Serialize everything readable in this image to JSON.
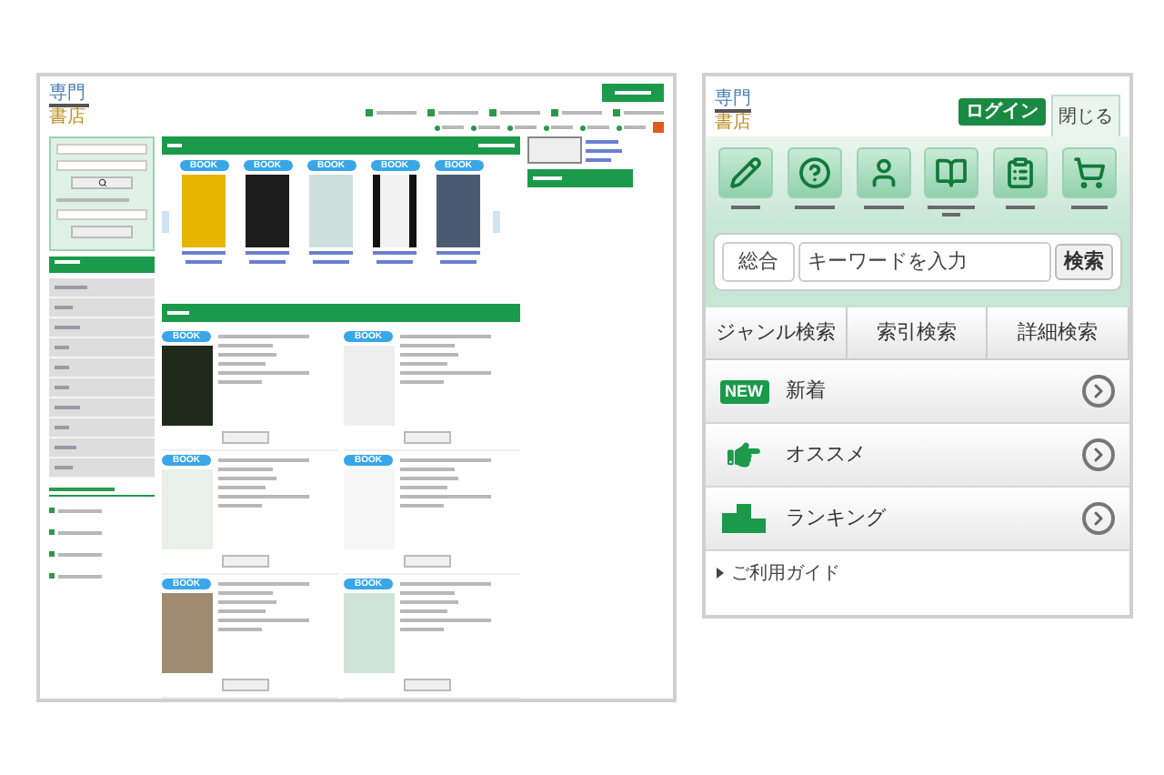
{
  "desktop": {
    "logo": [
      "専門",
      "書店"
    ],
    "new_books": [
      {
        "tag": "BOOK"
      },
      {
        "tag": "BOOK"
      },
      {
        "tag": "BOOK"
      },
      {
        "tag": "BOOK"
      },
      {
        "tag": "BOOK"
      }
    ],
    "recommended": [
      {
        "tag": "BOOK"
      },
      {
        "tag": "BOOK"
      },
      {
        "tag": "BOOK"
      },
      {
        "tag": "BOOK"
      },
      {
        "tag": "BOOK"
      },
      {
        "tag": "BOOK"
      }
    ]
  },
  "mobile": {
    "logo": [
      "専門",
      "書店"
    ],
    "login": "ログイン",
    "close": "閉じる",
    "search": {
      "scope": "総合",
      "placeholder": "キーワードを入力",
      "button": "検索"
    },
    "tabs": [
      "ジャンル検索",
      "索引検索",
      "詳細検索"
    ],
    "list": [
      {
        "kind": "new",
        "badge": "NEW",
        "label": "新着"
      },
      {
        "kind": "recommend",
        "label": "オススメ"
      },
      {
        "kind": "ranking",
        "label": "ランキング"
      }
    ],
    "guide": "ご利用ガイド"
  }
}
